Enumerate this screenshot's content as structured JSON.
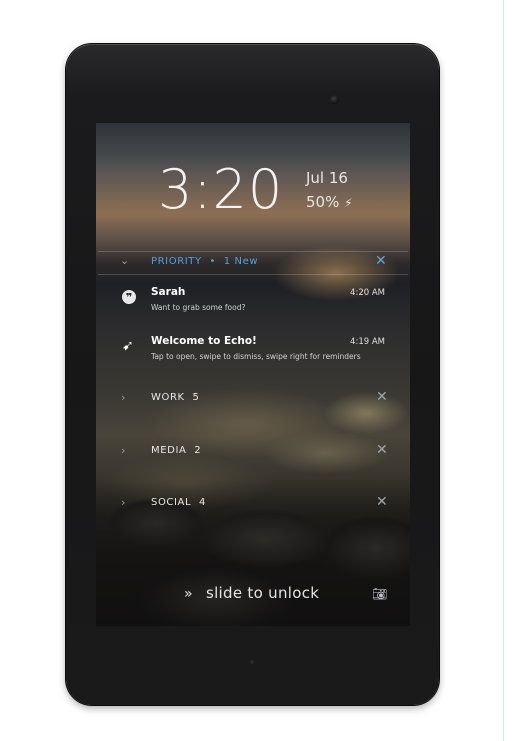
{
  "lockscreen": {
    "time": "3:20",
    "date": "Jul 16",
    "battery": "50%",
    "charging_icon": "lightning-bolt-icon"
  },
  "priority": {
    "label": "PRIORITY",
    "separator": "•",
    "new_text": "1 New",
    "accent": "#4fa0e0"
  },
  "notifications": [
    {
      "icon": "hangouts-quote-icon",
      "title": "Sarah",
      "text": "Want to grab some food?",
      "time": "4:20 AM"
    },
    {
      "icon": "echo-arrow-icon",
      "title": "Welcome to Echo!",
      "text": "Tap to open, swipe to dismiss, swipe right for reminders",
      "time": "4:19 AM"
    }
  ],
  "categories": [
    {
      "label": "WORK",
      "count": "5"
    },
    {
      "label": "MEDIA",
      "count": "2"
    },
    {
      "label": "SOCIAL",
      "count": "4"
    }
  ],
  "unlock": {
    "text": "slide to unlock",
    "arrows_icon": "double-chevron-right-icon",
    "camera_icon": "camera-icon"
  }
}
